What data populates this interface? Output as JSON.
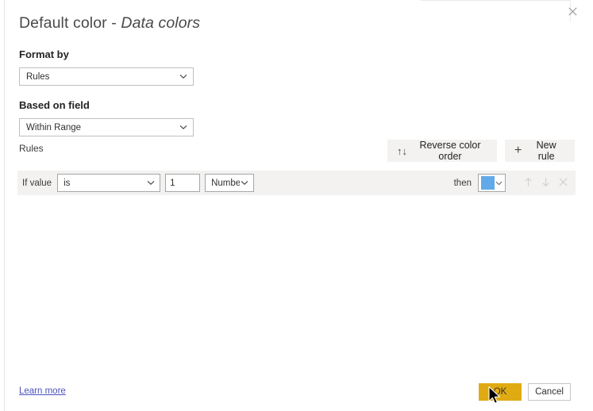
{
  "dialog": {
    "title_main": "Default color - ",
    "title_emphasis": "Data colors",
    "close_icon": "close-icon"
  },
  "format_by": {
    "label": "Format by",
    "value": "Rules",
    "chevron_icon": "chevron-down-icon"
  },
  "based_on_field": {
    "label": "Based on field",
    "value": "Within Range",
    "chevron_icon": "chevron-down-icon"
  },
  "rules_section": {
    "label": "Rules",
    "reverse_color_order": {
      "label": "Reverse color order",
      "icon": "up-down-arrows-icon",
      "glyph": "↑↓"
    },
    "new_rule": {
      "label": "New rule",
      "icon": "plus-icon",
      "glyph": "+"
    }
  },
  "rule": {
    "if_value_label": "If value",
    "condition": "is",
    "condition_chevron_icon": "chevron-down-icon",
    "value": "1",
    "value_placeholder": "",
    "value_type": "Number",
    "value_type_chevron_icon": "chevron-down-icon",
    "then_label": "then",
    "color_swatch_hex": "#61A9E8",
    "color_chevron_icon": "chevron-down-icon",
    "move_up_icon": "arrow-up-icon",
    "move_down_icon": "arrow-down-icon",
    "delete_icon": "close-icon"
  },
  "footer": {
    "learn_more": "Learn more",
    "ok": "OK",
    "cancel": "Cancel"
  },
  "colors": {
    "accent_ok": "#E0AB12",
    "link": "#4B53BC",
    "row_background": "#F3F2F1",
    "swatch_blue": "#61A9E8"
  },
  "cursor": {
    "icon": "mouse-pointer-icon"
  }
}
